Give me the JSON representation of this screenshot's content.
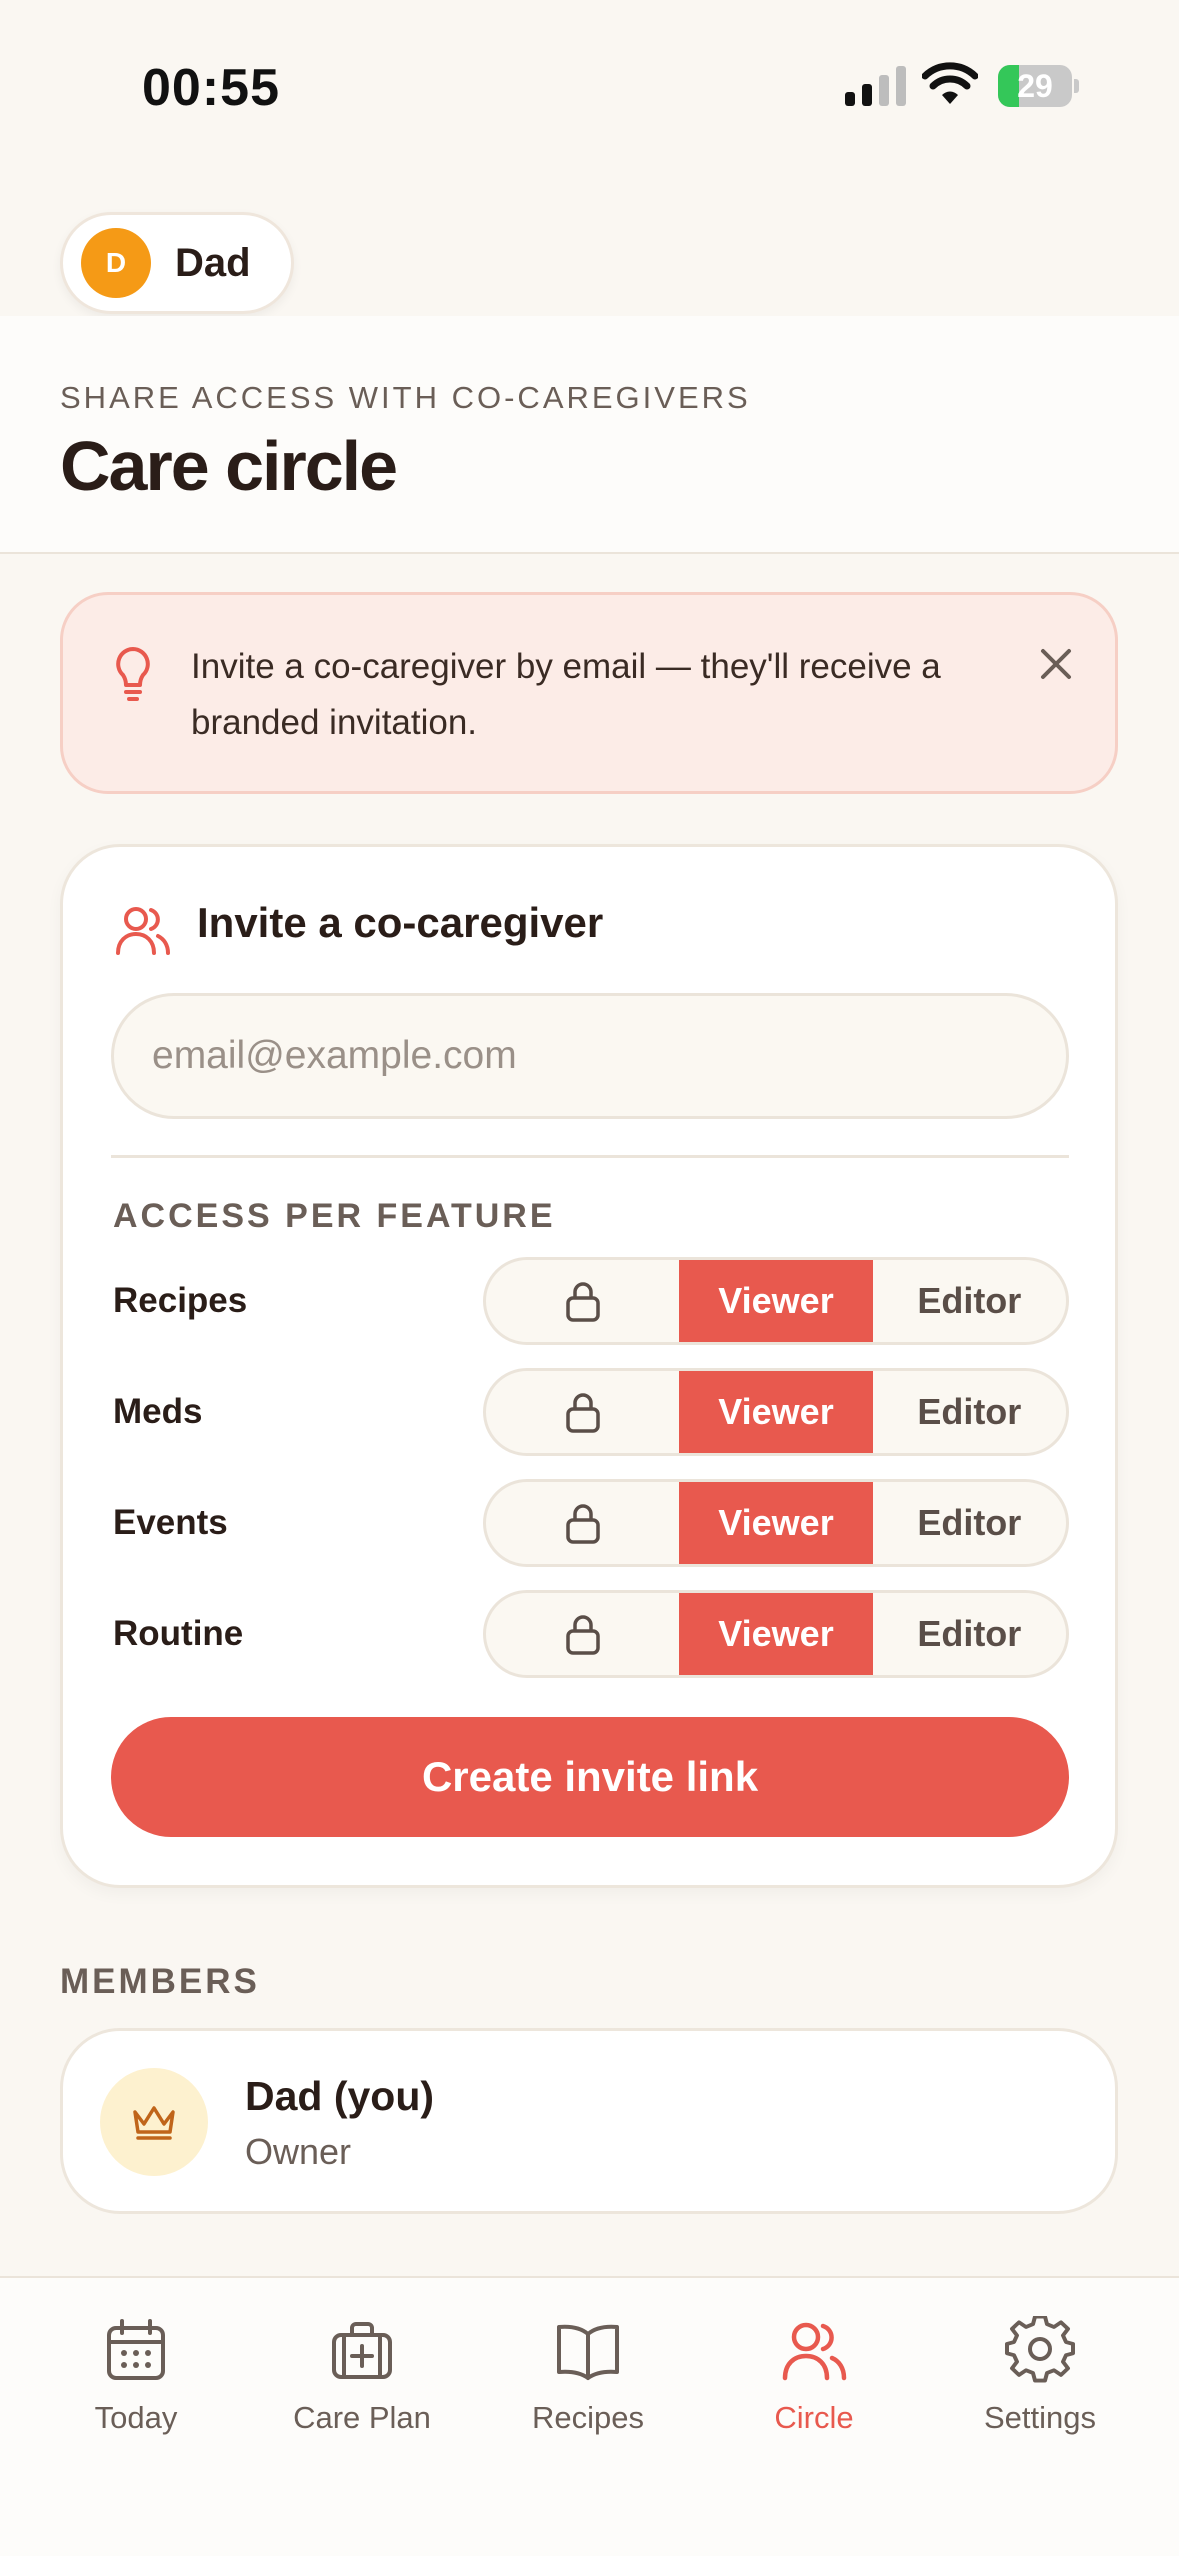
{
  "status_bar": {
    "time": "00:55",
    "battery_level": "29",
    "battery_fraction": 0.29
  },
  "profile": {
    "initial": "D",
    "name": "Dad"
  },
  "header": {
    "kicker": "SHARE ACCESS WITH CO-CAREGIVERS",
    "title": "Care circle"
  },
  "tip": {
    "text": "Invite a co-caregiver by email — they'll receive a branded invitation."
  },
  "invite": {
    "title": "Invite a co-caregiver",
    "email_value": "",
    "email_placeholder": "email@example.com",
    "access_title": "ACCESS PER FEATURE",
    "features": [
      {
        "label": "Recipes",
        "viewer": "Viewer",
        "editor": "Editor",
        "selected": "Viewer"
      },
      {
        "label": "Meds",
        "viewer": "Viewer",
        "editor": "Editor",
        "selected": "Viewer"
      },
      {
        "label": "Events",
        "viewer": "Viewer",
        "editor": "Editor",
        "selected": "Viewer"
      },
      {
        "label": "Routine",
        "viewer": "Viewer",
        "editor": "Editor",
        "selected": "Viewer"
      }
    ],
    "create_button": "Create invite link"
  },
  "members": {
    "title": "MEMBERS",
    "items": [
      {
        "name": "Dad (you)",
        "role": "Owner",
        "icon": "crown-icon"
      }
    ]
  },
  "tabs": [
    {
      "label": "Today",
      "icon": "calendar-icon",
      "active": false
    },
    {
      "label": "Care Plan",
      "icon": "medical-kit-icon",
      "active": false
    },
    {
      "label": "Recipes",
      "icon": "book-icon",
      "active": false
    },
    {
      "label": "Circle",
      "icon": "people-icon",
      "active": true
    },
    {
      "label": "Settings",
      "icon": "gear-icon",
      "active": false
    }
  ],
  "colors": {
    "accent": "#e8594e",
    "background": "#faf7f2",
    "avatar": "#f59a16",
    "text": "#2a1d18"
  }
}
